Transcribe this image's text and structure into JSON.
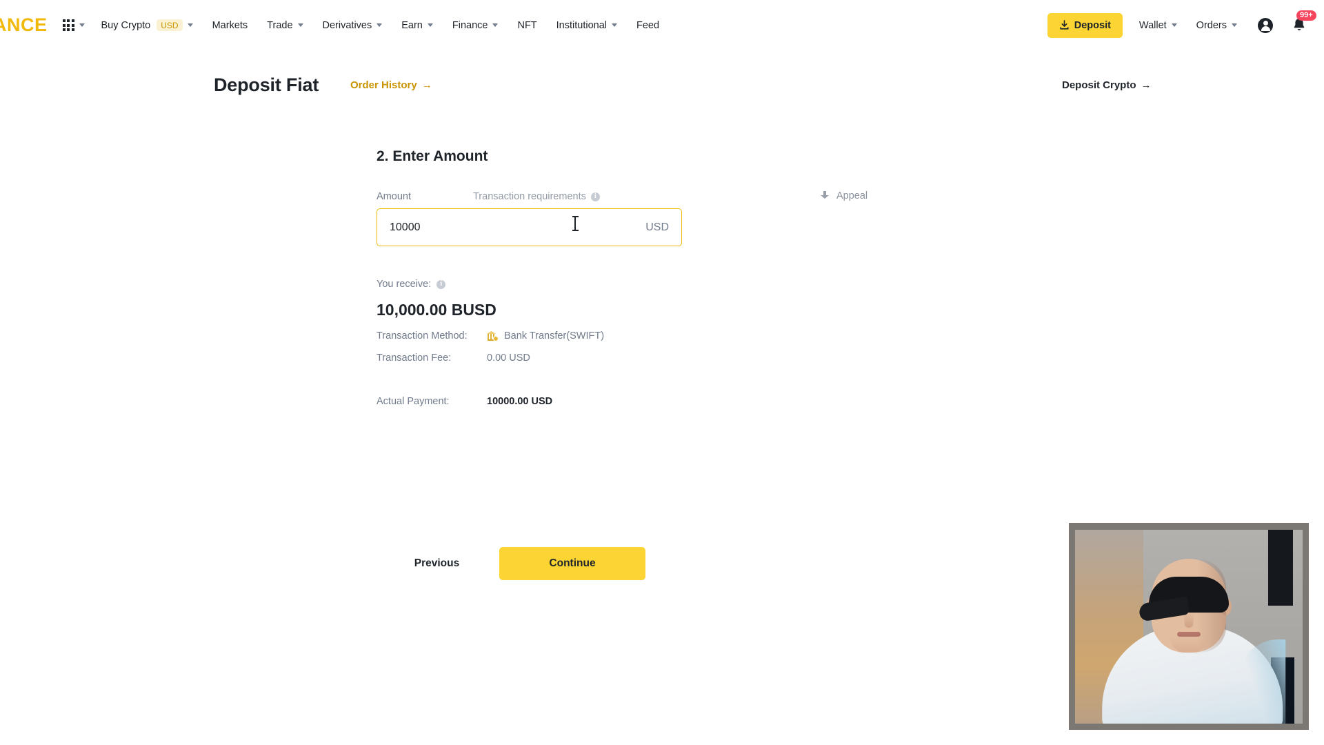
{
  "navbar": {
    "brand": "ANCE",
    "apps_icon": "grid-apps-icon",
    "items": [
      {
        "label": "Buy Crypto",
        "pill": "USD",
        "has_caret": true
      },
      {
        "label": "Markets",
        "has_caret": false
      },
      {
        "label": "Trade",
        "has_caret": true
      },
      {
        "label": "Derivatives",
        "has_caret": true
      },
      {
        "label": "Earn",
        "has_caret": true
      },
      {
        "label": "Finance",
        "has_caret": true
      },
      {
        "label": "NFT",
        "has_caret": false
      },
      {
        "label": "Institutional",
        "has_caret": true
      },
      {
        "label": "Feed",
        "has_caret": false
      }
    ],
    "deposit_button": "Deposit",
    "wallet": "Wallet",
    "orders": "Orders",
    "notification_badge": "99+",
    "accent_yellow": "#FCD535",
    "brand_gold": "#F0B90B",
    "badge_red": "#F6465D"
  },
  "header": {
    "title": "Deposit Fiat",
    "order_history": "Order History",
    "order_history_arrow": "→",
    "deposit_crypto": "Deposit Crypto",
    "deposit_crypto_arrow": "→"
  },
  "form": {
    "section_title": "2. Enter Amount",
    "amount_label": "Amount",
    "transaction_requirements": "Transaction requirements",
    "amount_value": "10000",
    "amount_placeholder": "10000",
    "currency": "USD",
    "you_receive_label": "You receive:",
    "you_receive_amount": "10,000.00 BUSD",
    "transaction_method_label": "Transaction Method:",
    "transaction_method_value": "Bank Transfer(SWIFT)",
    "transaction_fee_label": "Transaction Fee:",
    "transaction_fee_value": "0.00 USD",
    "actual_payment_label": "Actual Payment:",
    "actual_payment_value": "10000.00 USD",
    "input_border_color": "#F0B90B"
  },
  "appeal": {
    "label": "Appeal"
  },
  "buttons": {
    "previous": "Previous",
    "continue": "Continue"
  },
  "webcam": {
    "caption": ""
  }
}
